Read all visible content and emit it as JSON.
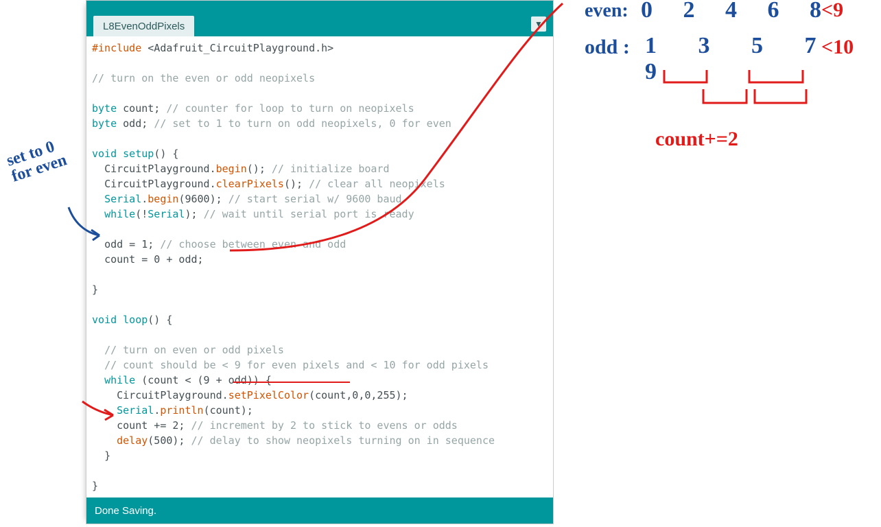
{
  "tab": {
    "label": "L8EvenOddPixels"
  },
  "status": "Done Saving.",
  "notes": {
    "even_label": "even:",
    "even_seq": "0 2 4 6 8",
    "even_limit": "<9",
    "odd_label": "odd :",
    "odd_seq": "1 3 5 7 9",
    "odd_limit": "<10",
    "countplus2": "count+=2",
    "set_to_0_l1": "set to 0",
    "set_to_0_l2": "for even"
  },
  "code": [
    {
      "indent": 0,
      "tokens": [
        [
          "fn",
          "#include"
        ],
        [
          "txt",
          " <Adafruit_CircuitPlayground.h>"
        ]
      ]
    },
    {
      "indent": 0,
      "tokens": []
    },
    {
      "indent": 0,
      "tokens": [
        [
          "c",
          "// turn on the even or odd neopixels"
        ]
      ]
    },
    {
      "indent": 0,
      "tokens": []
    },
    {
      "indent": 0,
      "tokens": [
        [
          "kw",
          "byte"
        ],
        [
          "txt",
          " count; "
        ],
        [
          "c",
          "// counter for loop to turn on neopixels"
        ]
      ]
    },
    {
      "indent": 0,
      "tokens": [
        [
          "kw",
          "byte"
        ],
        [
          "txt",
          " odd; "
        ],
        [
          "c",
          "// set to 1 to turn on odd neopixels, 0 for even"
        ]
      ]
    },
    {
      "indent": 0,
      "tokens": []
    },
    {
      "indent": 0,
      "tokens": [
        [
          "kw",
          "void"
        ],
        [
          "txt",
          " "
        ],
        [
          "kw",
          "setup"
        ],
        [
          "txt",
          "() {"
        ]
      ]
    },
    {
      "indent": 1,
      "tokens": [
        [
          "txt",
          "CircuitPlayground."
        ],
        [
          "fn",
          "begin"
        ],
        [
          "txt",
          "(); "
        ],
        [
          "c",
          "// initialize board"
        ]
      ]
    },
    {
      "indent": 1,
      "tokens": [
        [
          "txt",
          "CircuitPlayground."
        ],
        [
          "fn",
          "clearPixels"
        ],
        [
          "txt",
          "(); "
        ],
        [
          "c",
          "// clear all neopixels"
        ]
      ]
    },
    {
      "indent": 1,
      "tokens": [
        [
          "kw",
          "Serial"
        ],
        [
          "txt",
          "."
        ],
        [
          "fn",
          "begin"
        ],
        [
          "txt",
          "(9600); "
        ],
        [
          "c",
          "// start serial w/ 9600 baud"
        ]
      ]
    },
    {
      "indent": 1,
      "tokens": [
        [
          "kw",
          "while"
        ],
        [
          "txt",
          "(!"
        ],
        [
          "kw",
          "Serial"
        ],
        [
          "txt",
          "); "
        ],
        [
          "c",
          "// wait until serial port is ready"
        ]
      ]
    },
    {
      "indent": 0,
      "tokens": []
    },
    {
      "indent": 1,
      "tokens": [
        [
          "txt",
          "odd = 1; "
        ],
        [
          "c",
          "// choose between even and odd"
        ]
      ]
    },
    {
      "indent": 1,
      "tokens": [
        [
          "txt",
          "count = 0 + odd;"
        ]
      ]
    },
    {
      "indent": 0,
      "tokens": []
    },
    {
      "indent": 0,
      "tokens": [
        [
          "txt",
          "}"
        ]
      ]
    },
    {
      "indent": 0,
      "tokens": []
    },
    {
      "indent": 0,
      "tokens": [
        [
          "kw",
          "void"
        ],
        [
          "txt",
          " "
        ],
        [
          "kw",
          "loop"
        ],
        [
          "txt",
          "() {"
        ]
      ]
    },
    {
      "indent": 0,
      "tokens": []
    },
    {
      "indent": 1,
      "tokens": [
        [
          "c",
          "// turn on even or odd pixels"
        ]
      ]
    },
    {
      "indent": 1,
      "tokens": [
        [
          "c",
          "// count should be < 9 for even pixels and < 10 for odd pixels"
        ]
      ]
    },
    {
      "indent": 1,
      "tokens": [
        [
          "kw",
          "while"
        ],
        [
          "txt",
          " (count < (9 + odd)) {"
        ]
      ]
    },
    {
      "indent": 2,
      "tokens": [
        [
          "txt",
          "CircuitPlayground."
        ],
        [
          "fn",
          "setPixelColor"
        ],
        [
          "txt",
          "(count,0,0,255);"
        ]
      ]
    },
    {
      "indent": 2,
      "tokens": [
        [
          "kw",
          "Serial"
        ],
        [
          "txt",
          "."
        ],
        [
          "fn",
          "println"
        ],
        [
          "txt",
          "(count);"
        ]
      ]
    },
    {
      "indent": 2,
      "tokens": [
        [
          "txt",
          "count += 2; "
        ],
        [
          "c",
          "// increment by 2 to stick to evens or odds"
        ]
      ]
    },
    {
      "indent": 2,
      "tokens": [
        [
          "fn",
          "delay"
        ],
        [
          "txt",
          "(500); "
        ],
        [
          "c",
          "// delay to show neopixels turning on in sequence"
        ]
      ]
    },
    {
      "indent": 1,
      "tokens": [
        [
          "txt",
          "}"
        ]
      ]
    },
    {
      "indent": 0,
      "tokens": []
    },
    {
      "indent": 0,
      "tokens": [
        [
          "txt",
          "}"
        ]
      ]
    }
  ]
}
